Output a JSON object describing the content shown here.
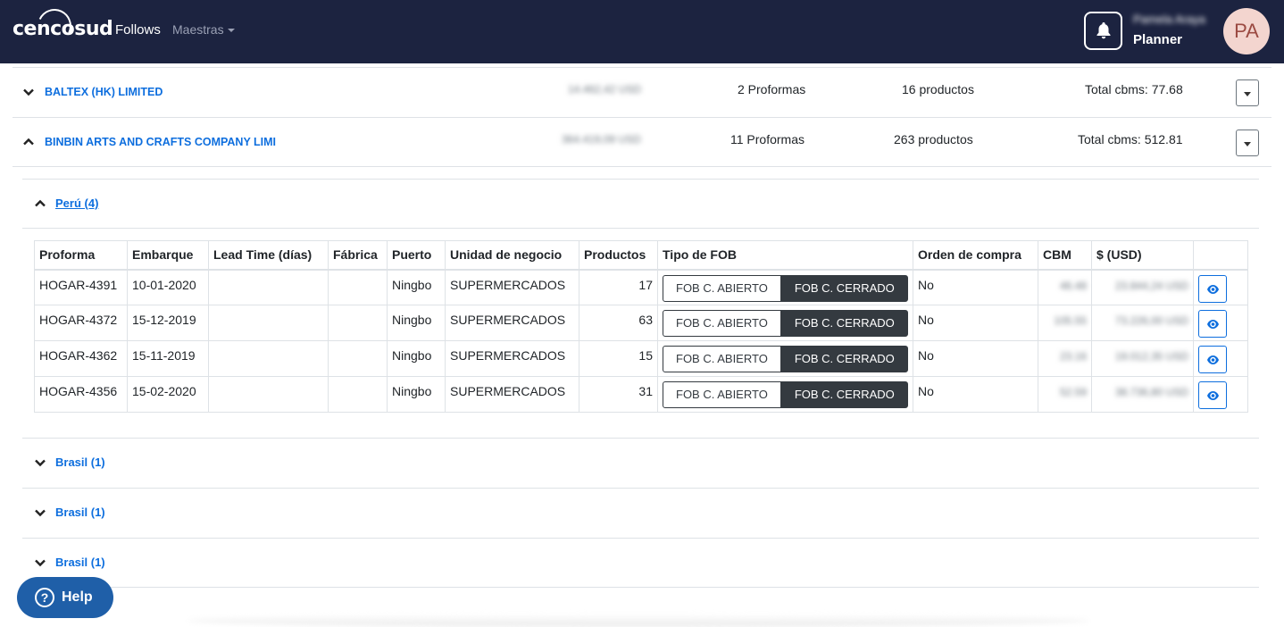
{
  "navbar": {
    "logo_text": "cencosud",
    "follows_label": "Follows",
    "maestras_label": "Maestras",
    "user_name": "Pamela Araya",
    "user_role": "Planner",
    "avatar_initials": "PA",
    "bg_color": "#1c2340"
  },
  "suppliers": [
    {
      "name": "BALTEX (HK) LIMITED",
      "amount": "14.462,42 USD",
      "proformas": "2 Proformas",
      "productos": "16 productos",
      "cbms": "Total cbms: 77.68",
      "expanded": false
    },
    {
      "name": "BINBIN ARTS AND CRAFTS COMPANY LIMI",
      "amount": "364.419,09 USD",
      "proformas": "11 Proformas",
      "productos": "263 productos",
      "cbms": "Total cbms: 512.81",
      "expanded": true
    }
  ],
  "countries": [
    {
      "label": "Perú (4)",
      "expanded": true
    },
    {
      "label": "Brasil (1)",
      "expanded": false
    },
    {
      "label": "Brasil (1)",
      "expanded": false
    },
    {
      "label": "Brasil (1)",
      "expanded": false
    }
  ],
  "table": {
    "headers": [
      "Proforma",
      "Embarque",
      "Lead Time (días)",
      "Fábrica",
      "Puerto",
      "Unidad de negocio",
      "Productos",
      "Tipo de FOB",
      "Orden de compra",
      "CBM",
      "$ (USD)",
      ""
    ],
    "fob_open_label": "FOB C. ABIERTO",
    "fob_closed_label": "FOB C. CERRADO",
    "rows": [
      {
        "proforma": "HOGAR-4391",
        "embarque": "10-01-2020",
        "lead_time": "",
        "fabrica": "",
        "puerto": "Ningbo",
        "unidad": "SUPERMERCADOS",
        "productos": "17",
        "orden": "No",
        "cbm": "46.48",
        "usd": "23.844,24 USD"
      },
      {
        "proforma": "HOGAR-4372",
        "embarque": "15-12-2019",
        "lead_time": "",
        "fabrica": "",
        "puerto": "Ningbo",
        "unidad": "SUPERMERCADOS",
        "productos": "63",
        "orden": "No",
        "cbm": "105.55",
        "usd": "73.226,00 USD"
      },
      {
        "proforma": "HOGAR-4362",
        "embarque": "15-11-2019",
        "lead_time": "",
        "fabrica": "",
        "puerto": "Ningbo",
        "unidad": "SUPERMERCADOS",
        "productos": "15",
        "orden": "No",
        "cbm": "23.16",
        "usd": "19.012,35 USD"
      },
      {
        "proforma": "HOGAR-4356",
        "embarque": "15-02-2020",
        "lead_time": "",
        "fabrica": "",
        "puerto": "Ningbo",
        "unidad": "SUPERMERCADOS",
        "productos": "31",
        "orden": "No",
        "cbm": "52.59",
        "usd": "38.736,80 USD"
      }
    ]
  },
  "help": {
    "label": "Help"
  },
  "colors": {
    "link": "#0d6ede",
    "dark_button": "#343a40",
    "help": "#1f5fa8"
  }
}
